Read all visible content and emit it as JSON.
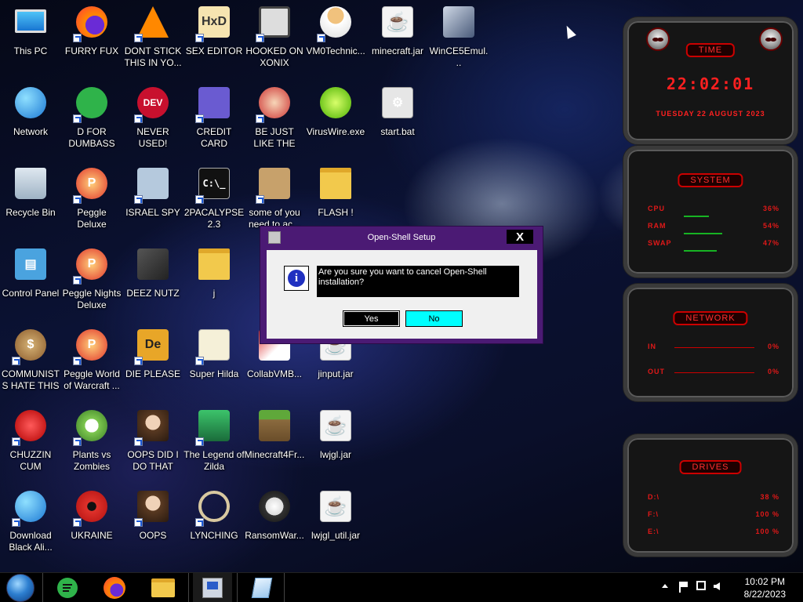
{
  "desktop_icons": [
    {
      "label": "This PC",
      "kind": "monitor",
      "col": 0,
      "row": 0,
      "shortcut": false
    },
    {
      "label": "FURRY FUX",
      "kind": "firefox",
      "col": 1,
      "row": 0,
      "shortcut": true
    },
    {
      "label": "DONT STICK THIS IN YO...",
      "kind": "vlc",
      "col": 2,
      "row": 0,
      "shortcut": true
    },
    {
      "label": "SEX EDITOR",
      "kind": "hxd",
      "col": 3,
      "row": 0,
      "shortcut": true
    },
    {
      "label": "HOOKED ON XONIX",
      "kind": "xonix",
      "col": 4,
      "row": 0,
      "shortcut": true
    },
    {
      "label": "VM0Technic...",
      "kind": "doctor",
      "col": 5,
      "row": 0,
      "shortcut": true
    },
    {
      "label": "minecraft.jar",
      "kind": "java",
      "col": 6,
      "row": 0,
      "shortcut": false
    },
    {
      "label": "WinCE5Emul...",
      "kind": "wince",
      "col": 7,
      "row": 0,
      "shortcut": false
    },
    {
      "label": "Network",
      "kind": "network",
      "col": 0,
      "row": 1,
      "shortcut": false
    },
    {
      "label": "D FOR DUMBASS",
      "kind": "dfor",
      "col": 1,
      "row": 1,
      "shortcut": true
    },
    {
      "label": "NEVER USED!",
      "kind": "devcpp",
      "col": 2,
      "row": 1,
      "shortcut": true
    },
    {
      "label": "CREDIT CARD CHECKER",
      "kind": "card",
      "col": 3,
      "row": 1,
      "shortcut": true
    },
    {
      "label": "BE JUST LIKE THE DUDE!",
      "kind": "elf",
      "col": 4,
      "row": 1,
      "shortcut": true
    },
    {
      "label": "VirusWire.exe",
      "kind": "lime",
      "col": 5,
      "row": 1,
      "shortcut": false
    },
    {
      "label": "start.bat",
      "kind": "gears",
      "col": 6,
      "row": 1,
      "shortcut": false
    },
    {
      "label": "Recycle Bin",
      "kind": "bin",
      "col": 0,
      "row": 2,
      "shortcut": false
    },
    {
      "label": "Peggle Deluxe",
      "kind": "peggle",
      "col": 1,
      "row": 2,
      "shortcut": true
    },
    {
      "label": "ISRAEL SPY",
      "kind": "spy",
      "col": 2,
      "row": 2,
      "shortcut": true
    },
    {
      "label": "2PACALYPSE 2.3",
      "kind": "cmd",
      "col": 3,
      "row": 2,
      "shortcut": true
    },
    {
      "label": "some of you need to ac...",
      "kind": "beaver",
      "col": 4,
      "row": 2,
      "shortcut": true
    },
    {
      "label": "FLASH !",
      "kind": "folder",
      "col": 5,
      "row": 2,
      "shortcut": false
    },
    {
      "label": "Control Panel",
      "kind": "cpanel",
      "col": 0,
      "row": 3,
      "shortcut": false
    },
    {
      "label": "Peggle Nights Deluxe",
      "kind": "peggle",
      "col": 1,
      "row": 3,
      "shortcut": true
    },
    {
      "label": "DEEZ NUTZ",
      "kind": "windows",
      "col": 2,
      "row": 3,
      "shortcut": false
    },
    {
      "label": "j",
      "kind": "folder",
      "col": 3,
      "row": 3,
      "shortcut": false
    },
    {
      "label": "COMMUNISTS HATE THIS G...",
      "kind": "moneybag",
      "col": 0,
      "row": 4,
      "shortcut": true
    },
    {
      "label": "Peggle World of Warcraft ...",
      "kind": "peggle",
      "col": 1,
      "row": 4,
      "shortcut": true
    },
    {
      "label": "DIE PLEASE",
      "kind": "dieplease",
      "col": 2,
      "row": 4,
      "shortcut": true
    },
    {
      "label": "Super Hilda",
      "kind": "pixel",
      "col": 3,
      "row": 4,
      "shortcut": true
    },
    {
      "label": "CollabVMB...",
      "kind": "collab",
      "col": 4,
      "row": 4,
      "shortcut": false
    },
    {
      "label": "jinput.jar",
      "kind": "java",
      "col": 5,
      "row": 4,
      "shortcut": false
    },
    {
      "label": "CHUZZIN CUM",
      "kind": "chuzzle",
      "col": 0,
      "row": 5,
      "shortcut": true
    },
    {
      "label": "Plants vs Zombies",
      "kind": "plant",
      "col": 1,
      "row": 5,
      "shortcut": true
    },
    {
      "label": "OOPS DID I DO THAT",
      "kind": "portrait",
      "col": 2,
      "row": 5,
      "shortcut": true
    },
    {
      "label": "The Legend of Zilda",
      "kind": "zelda",
      "col": 3,
      "row": 5,
      "shortcut": true
    },
    {
      "label": "Minecraft4Fr...",
      "kind": "grass",
      "col": 4,
      "row": 5,
      "shortcut": false
    },
    {
      "label": "lwjgl.jar",
      "kind": "java",
      "col": 5,
      "row": 5,
      "shortcut": false
    },
    {
      "label": "Download Black Ali...",
      "kind": "network",
      "col": 0,
      "row": 6,
      "shortcut": true
    },
    {
      "label": "UKRAINE",
      "kind": "radiation",
      "col": 1,
      "row": 6,
      "shortcut": true
    },
    {
      "label": "OOPS",
      "kind": "portrait64",
      "col": 2,
      "row": 6,
      "shortcut": true
    },
    {
      "label": "LYNCHING",
      "kind": "noose",
      "col": 3,
      "row": 6,
      "shortcut": true
    },
    {
      "label": "RansomWar...",
      "kind": "skull",
      "col": 4,
      "row": 6,
      "shortcut": false
    },
    {
      "label": "lwjgl_util.jar",
      "kind": "java",
      "col": 5,
      "row": 6,
      "shortcut": false
    }
  ],
  "widgets": {
    "time": {
      "title": "TIME",
      "clock": "22:02:01",
      "date": "TUESDAY 22 AUGUST 2023"
    },
    "system": {
      "title": "SYSTEM",
      "rows": [
        {
          "label": "CPU",
          "value": "36%",
          "fill": 0.36
        },
        {
          "label": "RAM",
          "value": "54%",
          "fill": 0.54
        },
        {
          "label": "SWAP",
          "value": "47%",
          "fill": 0.47
        }
      ]
    },
    "network": {
      "title": "NETWORK",
      "rows": [
        {
          "label": "IN",
          "value": "0%"
        },
        {
          "label": "OUT",
          "value": "0%"
        }
      ]
    },
    "drives": {
      "title": "DRIVES",
      "rows": [
        {
          "label": "D:\\",
          "value": "38 %"
        },
        {
          "label": "F:\\",
          "value": "100 %"
        },
        {
          "label": "E:\\",
          "value": "100 %"
        }
      ]
    }
  },
  "dialog": {
    "title": "Open-Shell Setup",
    "close_label": "X",
    "message": "Are you sure you want to cancel Open-Shell installation?",
    "yes_label": "Yes",
    "no_label": "No"
  },
  "taskbar": {
    "clock_time": "10:02 PM",
    "clock_date": "8/22/2023"
  },
  "colors": {
    "accent": "#ff2424",
    "dialog_frame": "#4b1a74",
    "no_button": "#00ffff"
  }
}
